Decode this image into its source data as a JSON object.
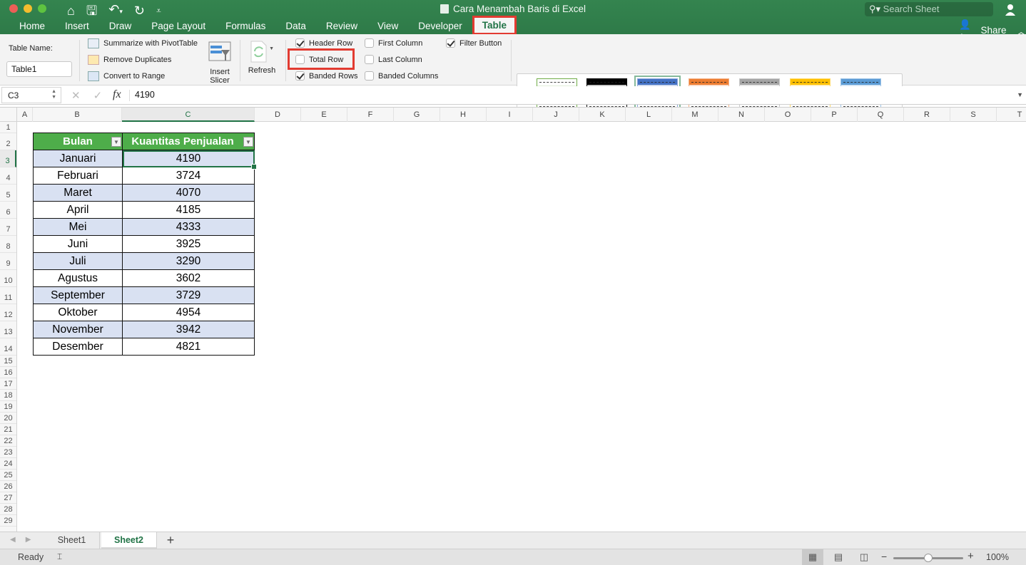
{
  "window": {
    "title": "Cara Menambah Baris di Excel",
    "search_placeholder": "Search Sheet",
    "share_label": "Share"
  },
  "quick_access": [
    "home-icon",
    "save-icon",
    "undo-icon",
    "redo-icon",
    "customize-icon"
  ],
  "tabs": [
    {
      "label": "Home"
    },
    {
      "label": "Insert"
    },
    {
      "label": "Draw"
    },
    {
      "label": "Page Layout"
    },
    {
      "label": "Formulas"
    },
    {
      "label": "Data"
    },
    {
      "label": "Review"
    },
    {
      "label": "View"
    },
    {
      "label": "Developer"
    },
    {
      "label": "Table",
      "active": true,
      "highlighted": true
    }
  ],
  "ribbon": {
    "table_name_label": "Table Name:",
    "table_name_value": "Table1",
    "tools": {
      "summarize": "Summarize with PivotTable",
      "remove_duplicates": "Remove Duplicates",
      "convert_to_range": "Convert to Range"
    },
    "insert_slicer": [
      "Insert",
      "Slicer"
    ],
    "refresh": "Refresh",
    "options": {
      "header_row": {
        "label": "Header Row",
        "checked": true
      },
      "total_row": {
        "label": "Total Row",
        "checked": false,
        "highlighted": true
      },
      "banded_rows": {
        "label": "Banded Rows",
        "checked": true
      },
      "first_column": {
        "label": "First Column",
        "checked": false
      },
      "last_column": {
        "label": "Last Column",
        "checked": false
      },
      "banded_columns": {
        "label": "Banded Columns",
        "checked": false
      },
      "filter_button": {
        "label": "Filter Button",
        "checked": true
      }
    },
    "table_styles": [
      {
        "name": "green-light",
        "header": "#ffffff",
        "band": "#e2efda",
        "border": "#70ad47"
      },
      {
        "name": "black",
        "header": "#000000",
        "band": "#d9d9d9",
        "border": "#000000"
      },
      {
        "name": "blue-medium",
        "header": "#4472c4",
        "band": "#d9e1f2",
        "border": "#8ea9db",
        "selected": true
      },
      {
        "name": "orange",
        "header": "#ed7d31",
        "band": "#fce4d6",
        "border": "#f4b084"
      },
      {
        "name": "gray",
        "header": "#a5a5a5",
        "band": "#ededed",
        "border": "#c9c9c9"
      },
      {
        "name": "gold",
        "header": "#ffc000",
        "band": "#fff2cc",
        "border": "#ffd966"
      },
      {
        "name": "light-blue",
        "header": "#5b9bd5",
        "band": "#ddebf7",
        "border": "#9bc2e6"
      }
    ]
  },
  "formula_bar": {
    "name_box": "C3",
    "formula": "4190"
  },
  "columns": [
    "A",
    "B",
    "C",
    "D",
    "E",
    "F",
    "G",
    "H",
    "I",
    "J",
    "K",
    "L",
    "M",
    "N",
    "O",
    "P",
    "Q",
    "R",
    "S",
    "T"
  ],
  "rows": [
    "1",
    "2",
    "3",
    "4",
    "5",
    "6",
    "7",
    "8",
    "9",
    "10",
    "11",
    "12",
    "13",
    "14",
    "15",
    "16",
    "17",
    "18",
    "19",
    "20",
    "21",
    "22",
    "23",
    "24",
    "25",
    "26",
    "27",
    "28",
    "29"
  ],
  "active_cell": {
    "column": "C",
    "row": "3"
  },
  "table": {
    "headers": [
      "Bulan",
      "Kuantitas Penjualan"
    ],
    "rows": [
      [
        "Januari",
        "4190"
      ],
      [
        "Februari",
        "3724"
      ],
      [
        "Maret",
        "4070"
      ],
      [
        "April",
        "4185"
      ],
      [
        "Mei",
        "4333"
      ],
      [
        "Juni",
        "3925"
      ],
      [
        "Juli",
        "3290"
      ],
      [
        "Agustus",
        "3602"
      ],
      [
        "September",
        "3729"
      ],
      [
        "Oktober",
        "4954"
      ],
      [
        "November",
        "3942"
      ],
      [
        "Desember",
        "4821"
      ]
    ],
    "header_color": "#4ead4a",
    "band_color": "#d9e1f2"
  },
  "sheets": [
    {
      "label": "Sheet1"
    },
    {
      "label": "Sheet2",
      "active": true
    }
  ],
  "status": {
    "ready": "Ready",
    "zoom": "100%",
    "zoom_fraction": 0.5
  },
  "colors": {
    "accent": "#217346",
    "titlebar": "#2f7d4a",
    "highlight": "#e23b31"
  }
}
